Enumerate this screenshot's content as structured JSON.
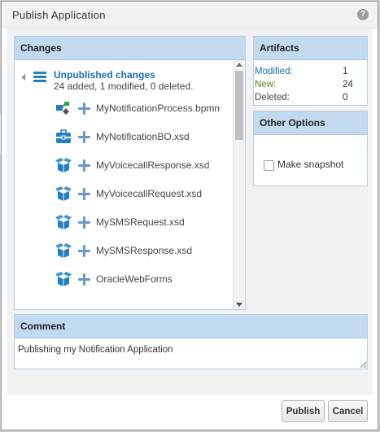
{
  "dialog": {
    "title": "Publish Application",
    "help_symbol": "?"
  },
  "changes": {
    "header": "Changes",
    "root": {
      "title": "Unpublished changes",
      "summary": "24 added, 1 modified, 0 deleted."
    },
    "items": [
      {
        "name": "MyNotificationProcess.bpmn",
        "icon": "process-icon"
      },
      {
        "name": "MyNotificationBO.xsd",
        "icon": "business-object-icon"
      },
      {
        "name": "MyVoicecallResponse.xsd",
        "icon": "box-icon"
      },
      {
        "name": "MyVoicecallRequest.xsd",
        "icon": "box-icon"
      },
      {
        "name": "MySMSRequest.xsd",
        "icon": "box-icon"
      },
      {
        "name": "MySMSResponse.xsd",
        "icon": "box-icon"
      },
      {
        "name": "OracleWebForms",
        "icon": "box-icon"
      }
    ],
    "change_icon": "plus-icon"
  },
  "artifacts": {
    "header": "Artifacts",
    "rows": [
      {
        "label": "Modified:",
        "value": "1",
        "color": "#1b6eb2"
      },
      {
        "label": "New:",
        "value": "24",
        "color": "#4b8a14"
      },
      {
        "label": "Deleted:",
        "value": "0",
        "color": "#444444"
      }
    ]
  },
  "options": {
    "header": "Other Options",
    "snapshot_label": "Make snapshot",
    "snapshot_checked": false
  },
  "comment": {
    "header": "Comment",
    "value": "Publishing my Notification Application"
  },
  "buttons": {
    "publish": "Publish",
    "cancel": "Cancel"
  }
}
